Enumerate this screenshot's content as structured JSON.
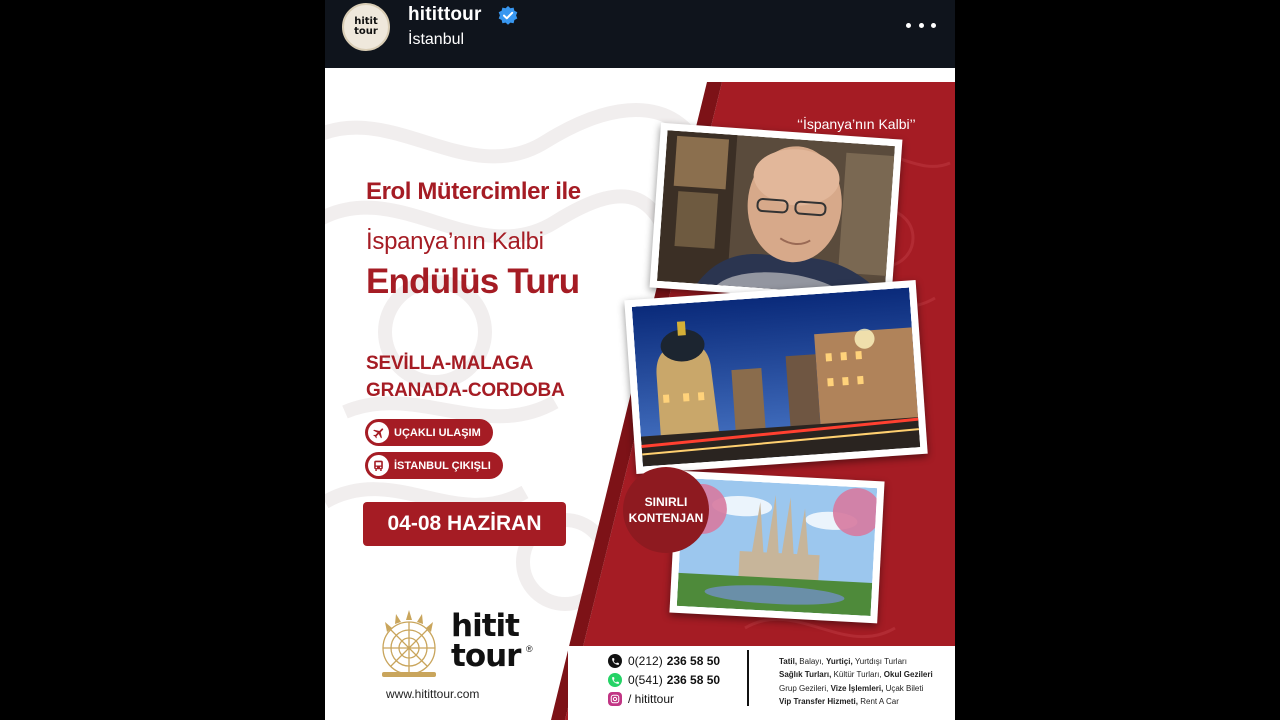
{
  "header": {
    "username": "hitittour",
    "location": "İstanbul",
    "avatar_text_1": "hitit",
    "avatar_text_2": "tour"
  },
  "flyer": {
    "quote": "‘‘İspanya’nın Kalbi’’",
    "headline_1": "Erol Mütercimler ile",
    "headline_2": "İspanya’nın Kalbi",
    "headline_3": "Endülüs Turu",
    "cities_1": "SEVİLLA-MALAGA",
    "cities_2": "GRANADA-CORDOBA",
    "pill_1": "UÇAKLI ULAŞIM",
    "pill_2": "İSTANBUL ÇIKIŞLI",
    "date": "04-08 HAZİRAN",
    "badge_1": "SINIRLI",
    "badge_2": "KONTENJAN",
    "logo_word_1": "hitit",
    "logo_word_2": "tour",
    "logo_reg": "®",
    "website": "www.hitittour.com",
    "phone_1_prefix": "0(212)",
    "phone_1": "236 58 50",
    "phone_2_prefix": "0(541)",
    "phone_2": "236 58 50",
    "instagram": "/ hitittour",
    "services": [
      [
        "Tatil, ",
        "Balayı, ",
        "Yurtiçi, ",
        "Yurtdışı Turları"
      ],
      [
        "Sağlık Turları, ",
        "Kültür Turları, ",
        "Okul Gezileri"
      ],
      [
        "Grup Gezileri, ",
        "Vize İşlemleri, ",
        "Uçak Bileti"
      ],
      [
        "Vip Transfer Hizmeti, ",
        "Rent A Car"
      ]
    ]
  },
  "colors": {
    "brand_red": "#a51c24",
    "topbar": "#0f141c",
    "verified": "#3897f0"
  },
  "icons": [
    "verified-badge-icon",
    "more-options-icon",
    "airplane-icon",
    "bus-icon",
    "phone-icon",
    "whatsapp-icon",
    "instagram-icon"
  ]
}
